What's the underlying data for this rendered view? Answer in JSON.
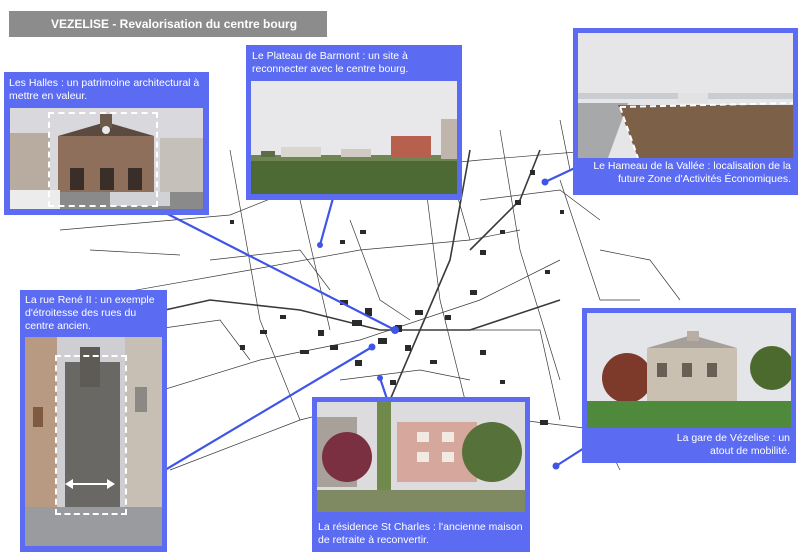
{
  "title": "VEZELISE - Revalorisation du centre bourg",
  "callouts": {
    "halles": "Les Halles : un patrimoine architectural à mettre en valeur.",
    "plateau": "Le Plateau de Barmont : un site à reconnecter avec le centre bourg.",
    "hameau": "Le Hameau de la Vallée : localisation de la future Zone d'Activités Économiques.",
    "rene": "La rue René II : un exemple d'étroitesse des rues du centre ancien.",
    "gare": "La gare de Vézelise : un atout de mobilité.",
    "residence": "La résidence St Charles : l'ancienne maison de retraite à reconvertir."
  },
  "colors": {
    "callout_fill": "#5b6cf3",
    "leader_line": "#3e55e6",
    "title_fill": "#8c8c8c",
    "map_lines": "#3a3a3a"
  },
  "icons": [
    "double-arrow-icon"
  ]
}
